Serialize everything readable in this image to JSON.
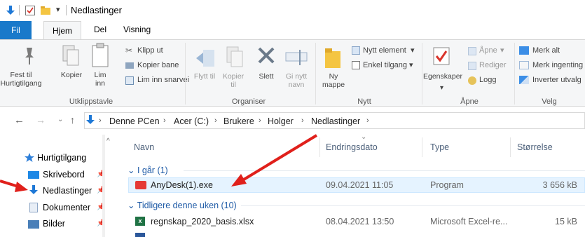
{
  "window": {
    "title": "Nedlastinger"
  },
  "tabs": [
    {
      "label": "Fil"
    },
    {
      "label": "Hjem"
    },
    {
      "label": "Del"
    },
    {
      "label": "Visning"
    }
  ],
  "ribbon": {
    "utklipp": {
      "label": "Utklippstavle",
      "pin": "Fest til Hurtigtilgang",
      "copy": "Kopier",
      "paste": "Lim inn",
      "cut": "Klipp ut",
      "copy_path": "Kopier bane",
      "paste_shortcut": "Lim inn snarvei"
    },
    "organiser": {
      "label": "Organiser",
      "move": "Flytt til",
      "copy_to": "Kopier til",
      "delete": "Slett",
      "rename": "Gi nytt navn"
    },
    "nytt": {
      "label": "Nytt",
      "new_folder": "Ny mappe",
      "new_item": "Nytt element",
      "easy_access": "Enkel tilgang"
    },
    "apne": {
      "label": "Åpne",
      "properties": "Egenskaper",
      "open": "Åpne",
      "edit": "Rediger",
      "history": "Logg"
    },
    "velg": {
      "label": "Velg",
      "select_all": "Merk alt",
      "select_none": "Merk ingenting",
      "invert": "Inverter utvalg"
    }
  },
  "address": {
    "crumbs": [
      "Denne PCen",
      "Acer (C:)",
      "Brukere",
      "Holger",
      "Nedlastinger"
    ]
  },
  "nav": {
    "items": [
      {
        "label": "Hurtigtilgang"
      },
      {
        "label": "Skrivebord"
      },
      {
        "label": "Nedlastinger"
      },
      {
        "label": "Dokumenter"
      },
      {
        "label": "Bilder"
      }
    ]
  },
  "columns": {
    "name": "Navn",
    "date": "Endringsdato",
    "type": "Type",
    "size": "Størrelse"
  },
  "groups": [
    {
      "label": "I går (1)"
    },
    {
      "label": "Tidligere denne uken (10)"
    }
  ],
  "files": [
    {
      "name": "AnyDesk(1).exe",
      "date": "09.04.2021 11:05",
      "type": "Program",
      "size": "3 656 kB"
    },
    {
      "name": "regnskap_2020_basis.xlsx",
      "date": "08.04.2021 13:50",
      "type": "Microsoft Excel-re...",
      "size": "15 kB"
    }
  ],
  "colors": {
    "accent": "#1979ca",
    "selection": "#e5f3ff",
    "arrow": "#e0201b",
    "group_text": "#1e5aa6"
  }
}
